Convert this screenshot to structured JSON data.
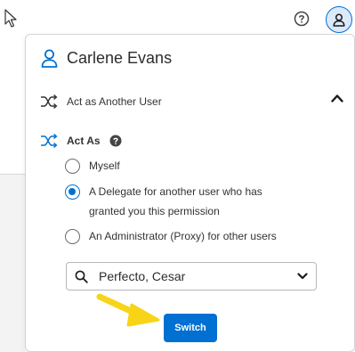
{
  "header": {
    "help_icon": "question-circle-icon",
    "profile_icon": "user-icon"
  },
  "popover": {
    "user_name": "Carlene Evans",
    "act_as_another_user_label": "Act as Another User",
    "act_as_title": "Act As",
    "options": [
      {
        "label_line1": "Myself",
        "label_line2": "",
        "checked": false
      },
      {
        "label_line1": "A Delegate for another user who has",
        "label_line2": "granted you this permission",
        "checked": true
      },
      {
        "label_line1": "An Administrator (Proxy) for other users",
        "label_line2": "",
        "checked": false
      }
    ],
    "search_select_value": "Perfecto, Cesar",
    "switch_label": "Switch"
  },
  "colors": {
    "accent": "#0070d2",
    "annotation_arrow": "#f7d417"
  }
}
